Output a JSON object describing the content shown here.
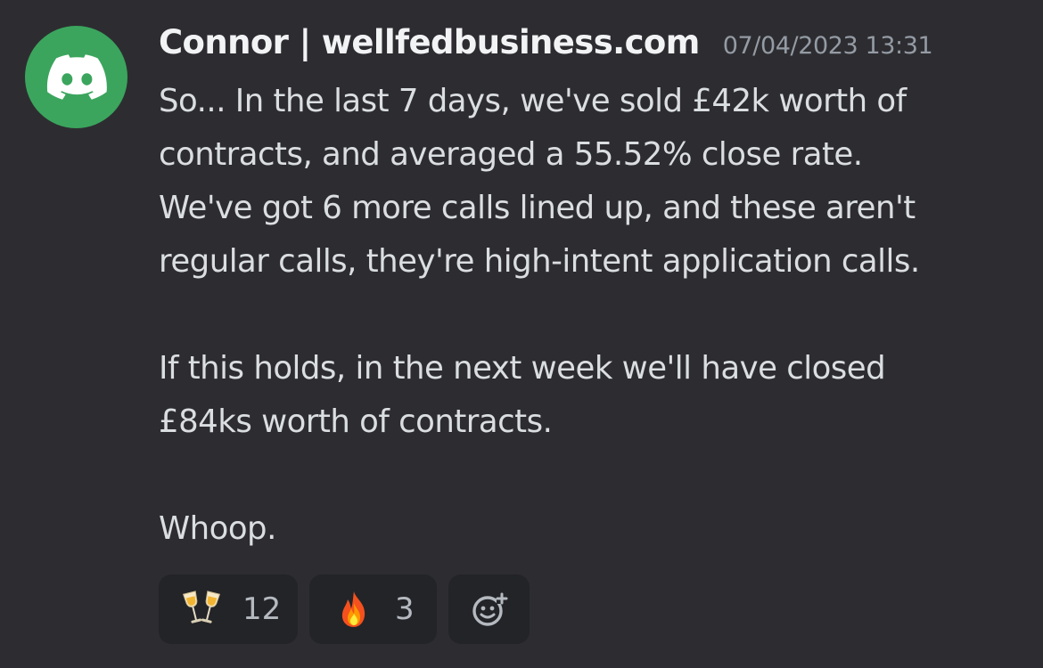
{
  "message": {
    "author": "Connor | wellfedbusiness.com",
    "timestamp": "07/04/2023 13:31",
    "avatar_icon": "discord-logo-icon",
    "avatar_color": "#3ba55d",
    "paragraphs": [
      {
        "lines": [
          "So... In the last 7 days, we've sold £42k worth of",
          "contracts, and averaged a 55.52% close rate.",
          "We've got 6 more calls lined up, and these aren't",
          "regular calls, they're high-intent application calls."
        ]
      },
      {
        "lines": [
          "If this holds, in the next week we'll have closed",
          "£84ks worth of contracts."
        ]
      },
      {
        "lines": [
          "Whoop."
        ]
      }
    ]
  },
  "reactions": [
    {
      "emoji": "clinking-glasses-icon",
      "count": "12"
    },
    {
      "emoji": "fire-icon",
      "count": "3"
    }
  ],
  "add_reaction_icon": "add-reaction-icon"
}
